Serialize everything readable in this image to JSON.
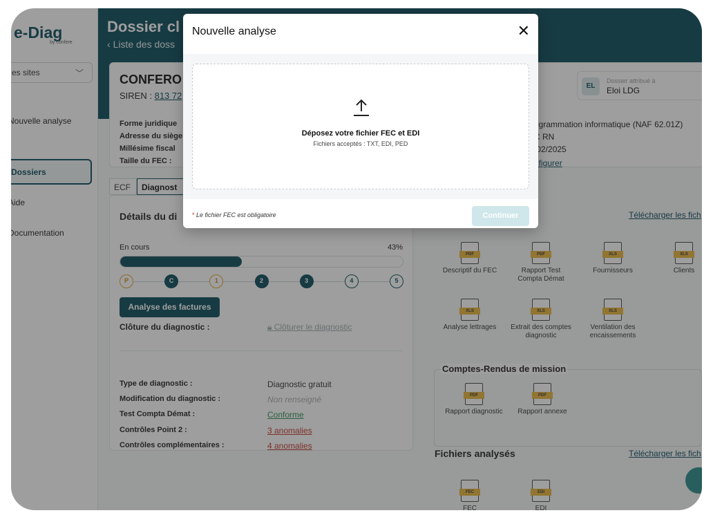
{
  "sidebar": {
    "logo": "e-Diag",
    "logo_sub": "by confere",
    "sites_label": "es sites",
    "items": [
      {
        "label": "Nouvelle analyse"
      },
      {
        "label": "Dossiers"
      },
      {
        "label": "Aide"
      },
      {
        "label": "Documentation"
      }
    ]
  },
  "header": {
    "title": "Dossier cl",
    "breadcrumb": "Liste des doss"
  },
  "company": {
    "name": "CONFERO",
    "siren_label": "SIREN :",
    "siren_value": "813 72",
    "fields": [
      "Forme juridique",
      "Adresse du siège",
      "Millésime fiscal",
      "Taille du FEC :"
    ],
    "right_values": [
      "ogrammation informatique (NAF 62.01Z)",
      "C RN",
      "/02/2025",
      "nfigurer"
    ],
    "assigned_label": "Dossier attribué à",
    "assigned_name": "Eloi LDG",
    "avatar": "EL"
  },
  "tabs": [
    {
      "label": "ECF"
    },
    {
      "label": "Diagnost"
    }
  ],
  "diagnostic": {
    "heading": "Détails du di",
    "status": "En cours",
    "progress_pct": 43,
    "progress_label": "43%",
    "steps": [
      {
        "label": "P",
        "state": "pending"
      },
      {
        "label": "C",
        "state": "done"
      },
      {
        "label": "1",
        "state": "pending"
      },
      {
        "label": "2",
        "state": "done"
      },
      {
        "label": "3",
        "state": "done"
      },
      {
        "label": "4",
        "state": "todo"
      },
      {
        "label": "5",
        "state": "todo"
      }
    ],
    "action_button": "Analyse des factures",
    "cloture_label": "Clôture du diagnostic :",
    "cloture_link": "Clôturer le diagnostic",
    "rows": [
      {
        "k": "Type de diagnostic :",
        "v": "Diagnostic gratuit"
      },
      {
        "k": "Modification du diagnostic :",
        "v": "Non renseigné"
      },
      {
        "k": "Test Compta Démat :",
        "v": "Conforme"
      },
      {
        "k": "Contrôles Point 2 :",
        "v": "3 anomalies"
      },
      {
        "k": "Contrôles complémentaires :",
        "v": "4 anomalies"
      }
    ]
  },
  "documents": {
    "download_label": "Télécharger les fich",
    "items": [
      {
        "label": "Descriptif du FEC",
        "type": "PDF"
      },
      {
        "label": "Rapport Test Compta Démat",
        "type": "PDF"
      },
      {
        "label": "Fournisseurs",
        "type": "XLS"
      },
      {
        "label": "Clients",
        "type": "XLS"
      },
      {
        "label": "Analyse lettrages",
        "type": "XLS"
      },
      {
        "label": "Extrait des comptes diagnostic",
        "type": "XLS"
      },
      {
        "label": "Ventilation des encaissements",
        "type": "XLS"
      }
    ],
    "cr_title": "Comptes-Rendus de mission",
    "cr_items": [
      {
        "label": "Rapport diagnostic",
        "type": "PDF"
      },
      {
        "label": "Rapport annexe",
        "type": "PDF"
      }
    ],
    "files_title": "Fichiers analysés",
    "files_download": "Télécharger les fich",
    "file_items": [
      {
        "label": "FEC",
        "type": "FEC"
      },
      {
        "label": "EDI",
        "type": "EDI"
      }
    ]
  },
  "modal": {
    "title": "Nouvelle analyse",
    "drop_title": "Déposez votre fichier FEC et EDI",
    "drop_sub": "Fichiers acceptés : TXT, EDI, PED",
    "required_star": "*",
    "required_text": "Le fichier FEC est obligatoire",
    "continue": "Continuer"
  },
  "colors": {
    "brand": "#0a4b5a",
    "accent_yellow": "#e8b43a",
    "success": "#2f8f57",
    "error": "#c0392b"
  }
}
